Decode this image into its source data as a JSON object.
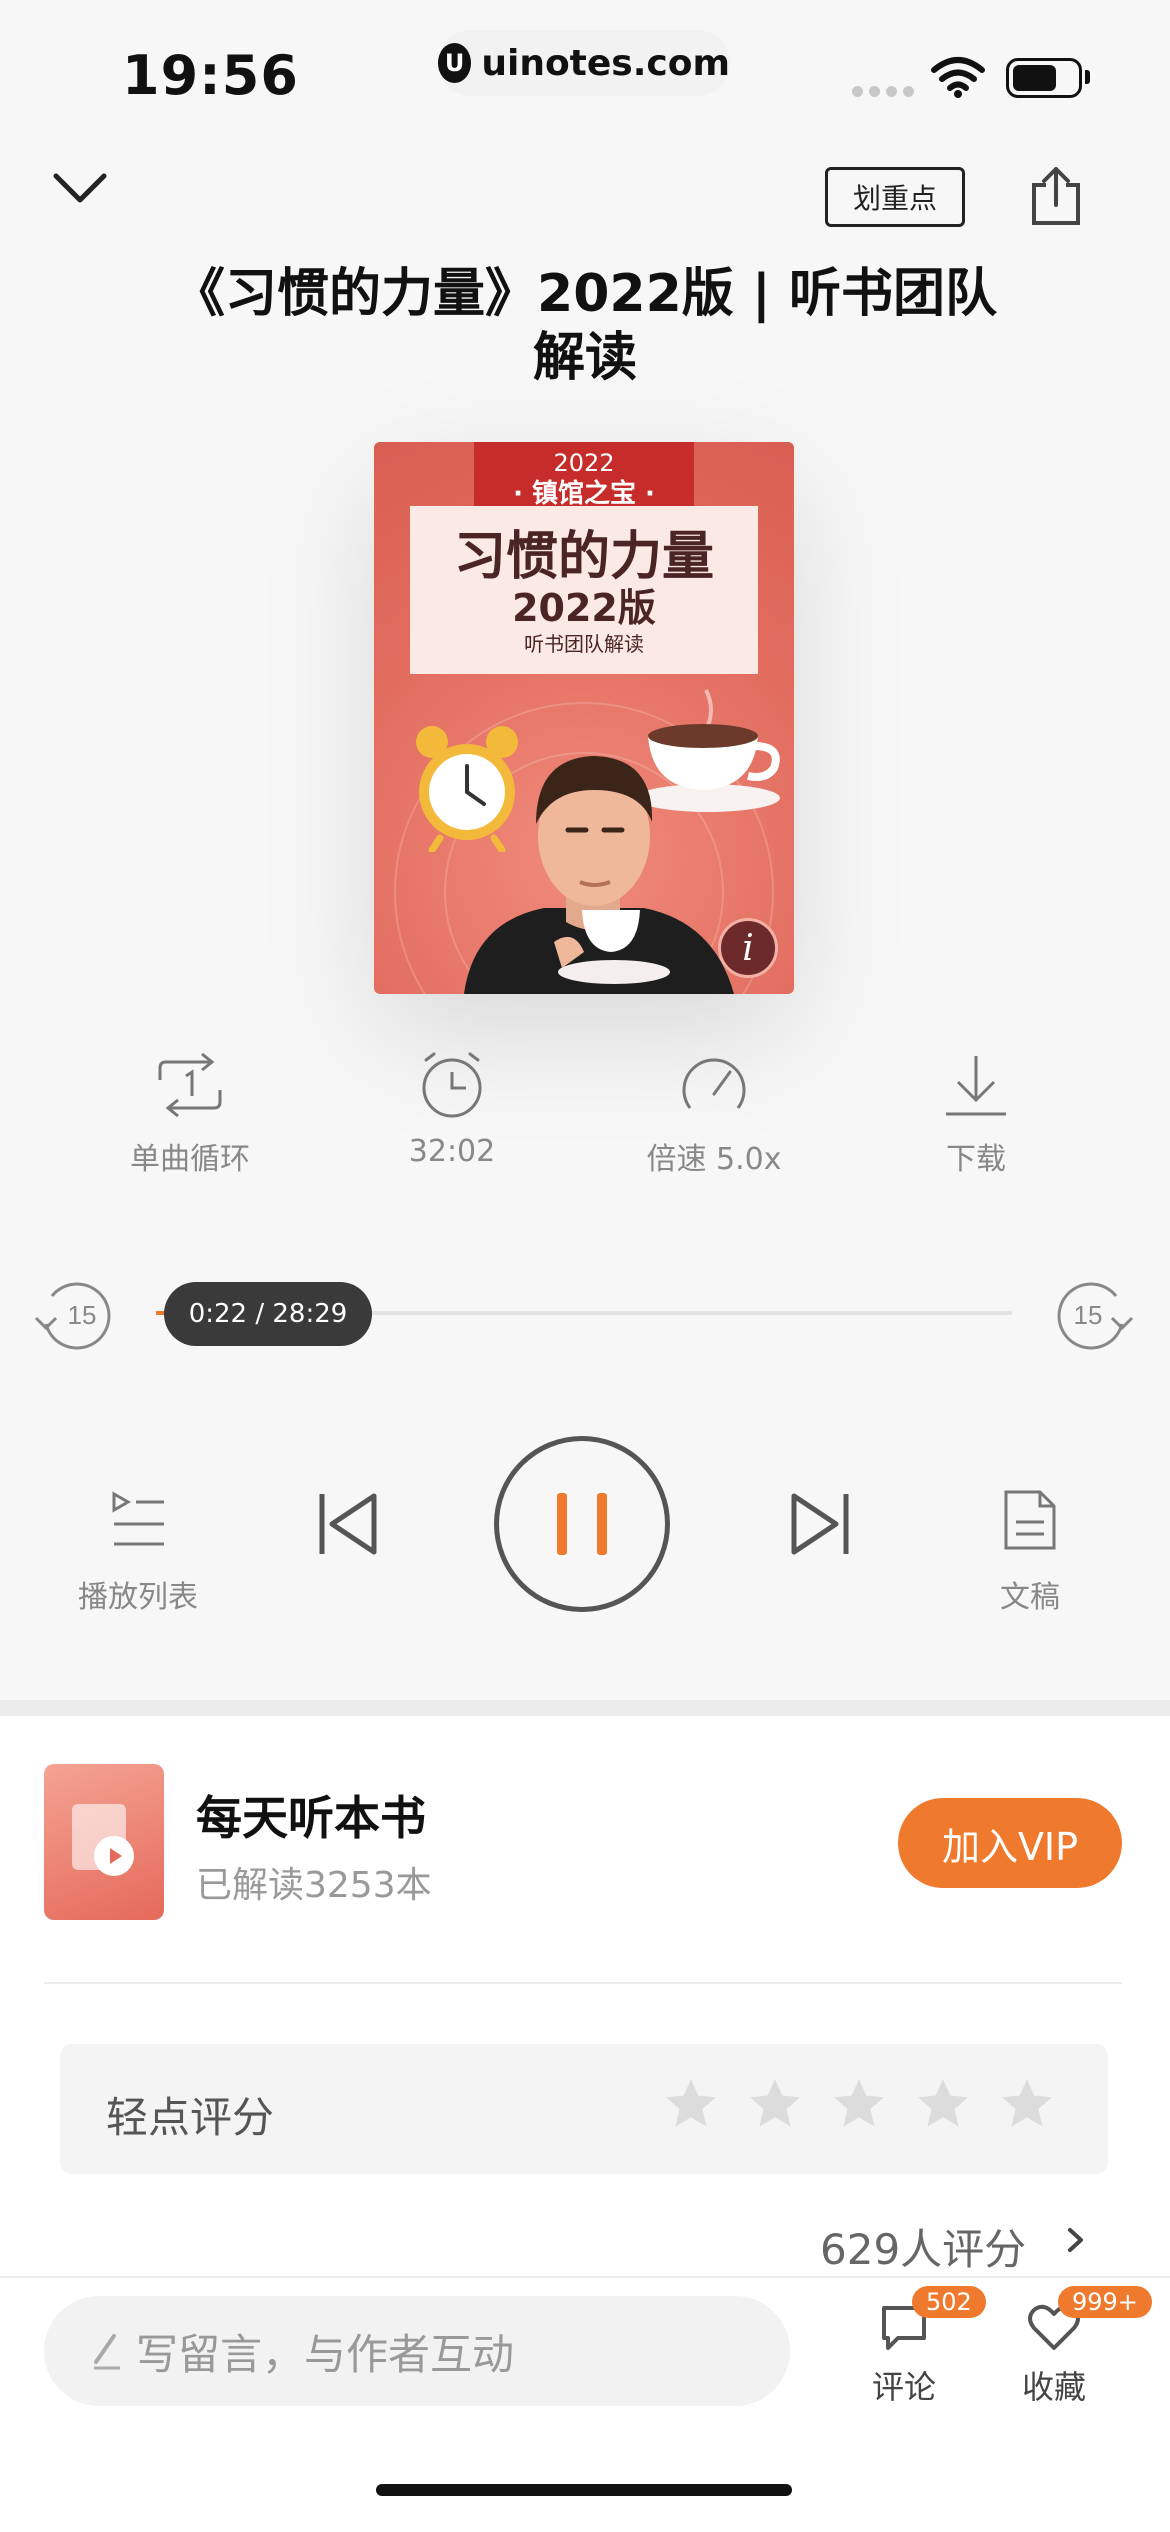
{
  "status_bar": {
    "time": "19:56",
    "url_logo": "U",
    "url": "uinotes.com"
  },
  "header": {
    "collapse_icon": "chevron-down-icon",
    "highlight_label": "划重点",
    "share_icon": "share-icon",
    "title": "《习惯的力量》2022版 | 听书团队解读"
  },
  "cover": {
    "year": "2022",
    "tag": "· 镇馆之宝 ·",
    "title_line1": "习惯的力量",
    "title_line2": "2022版",
    "title_line3": "听书团队解读",
    "info": "i"
  },
  "features": [
    {
      "icon": "repeat-one-icon",
      "label": "单曲循环"
    },
    {
      "icon": "timer-icon",
      "label": "32:02"
    },
    {
      "icon": "speed-icon",
      "label": "倍速 5.0x"
    },
    {
      "icon": "download-icon",
      "label": "下载"
    }
  ],
  "progress": {
    "current": "0:22",
    "total": "28:29",
    "display": "0:22 / 28:29",
    "fraction": 0.013,
    "skip_back": "15",
    "skip_forward": "15"
  },
  "controls": {
    "playlist_label": "播放列表",
    "transcript_label": "文稿",
    "state": "playing"
  },
  "promo": {
    "title": "每天听本书",
    "subtitle": "已解读3253本",
    "vip_button": "加入VIP"
  },
  "rating": {
    "label": "轻点评分",
    "stars": 5,
    "selected": 0,
    "count_text": "629人评分"
  },
  "comment_bar": {
    "placeholder": "写留言，与作者互动",
    "comments_label": "评论",
    "comments_badge": "502",
    "favorites_label": "收藏",
    "favorites_badge": "999+"
  },
  "colors": {
    "accent": "#ef7a2d",
    "background": "#f7f7f7",
    "cover": "#e26d5f"
  }
}
